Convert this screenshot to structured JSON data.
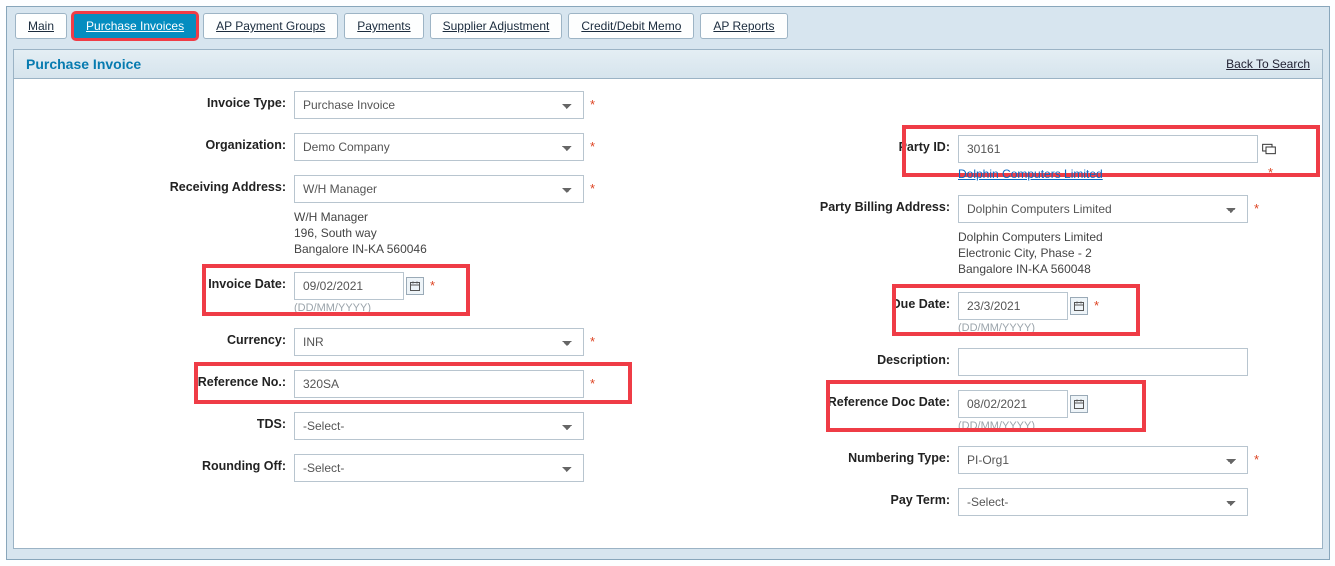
{
  "tabs": {
    "main": "Main",
    "purchase_invoices": "Purchase Invoices",
    "ap_payment_groups": "AP Payment Groups",
    "payments": "Payments",
    "supplier_adjustment": "Supplier Adjustment",
    "credit_debit_memo": "Credit/Debit Memo",
    "ap_reports": "AP Reports"
  },
  "panel": {
    "title": "Purchase Invoice",
    "back_link": "Back To Search"
  },
  "hints": {
    "date_fmt": "(DD/MM/YYYY)"
  },
  "left": {
    "invoice_type": {
      "label": "Invoice Type:",
      "value": "Purchase Invoice"
    },
    "organization": {
      "label": "Organization:",
      "value": "Demo Company"
    },
    "recv_addr": {
      "label": "Receiving Address:",
      "value": "W/H Manager",
      "l1": "W/H Manager",
      "l2": "196, South way",
      "l3": "Bangalore IN-KA 560046"
    },
    "invoice_date": {
      "label": "Invoice Date:",
      "value": "09/02/2021"
    },
    "currency": {
      "label": "Currency:",
      "value": "INR"
    },
    "reference_no": {
      "label": "Reference No.:",
      "value": "320SA"
    },
    "tds": {
      "label": "TDS:",
      "value": "-Select-"
    },
    "rounding_off": {
      "label": "Rounding Off:",
      "value": "-Select-"
    }
  },
  "right": {
    "party_id": {
      "label": "Party ID:",
      "value": "30161",
      "party_name": "Dolphin Computers Limited"
    },
    "bill_addr": {
      "label": "Party Billing Address:",
      "value": "Dolphin Computers Limited",
      "l1": "Dolphin Computers Limited",
      "l2": "Electronic City, Phase - 2",
      "l3": "Bangalore IN-KA 560048"
    },
    "due_date": {
      "label": "Due Date:",
      "value": "23/3/2021"
    },
    "description": {
      "label": "Description:",
      "value": ""
    },
    "ref_doc_date": {
      "label": "Reference Doc Date:",
      "value": "08/02/2021"
    },
    "numbering_type": {
      "label": "Numbering Type:",
      "value": "PI-Org1"
    },
    "pay_term": {
      "label": "Pay Term:",
      "value": "-Select-"
    }
  }
}
